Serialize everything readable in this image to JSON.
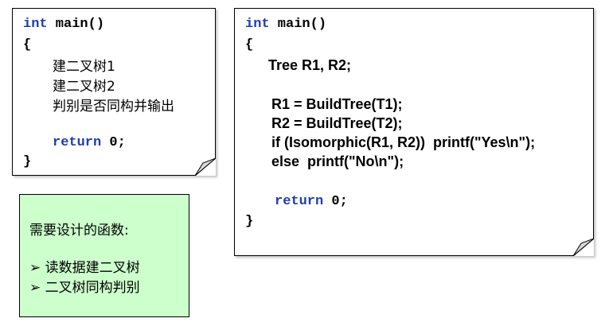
{
  "left_box": {
    "signature": "int main()",
    "brace_open": "{",
    "step1": "建二叉树1",
    "step2": "建二叉树2",
    "step3": "判别是否同构并输出",
    "return_kw": "return",
    "return_val": " 0;",
    "brace_close": "}"
  },
  "right_box": {
    "signature": "int main()",
    "brace_open": "{",
    "decl": "Tree R1, R2;",
    "line1": "R1 = BuildTree(T1);",
    "line2": "R2 = BuildTree(T2);",
    "line3": "if (Isomorphic(R1, R2))  printf(\"Yes\\n\");",
    "line4": "else  printf(\"No\\n\");",
    "return_kw": "return",
    "return_val": " 0;",
    "brace_close": "}"
  },
  "note_box": {
    "title": "需要设计的函数:",
    "items": [
      "读数据建二叉树",
      "二叉树同构判别"
    ],
    "bullet": "➢"
  },
  "colors": {
    "keyword": "#1f3ea8",
    "note_bg": "#ccffcc"
  }
}
